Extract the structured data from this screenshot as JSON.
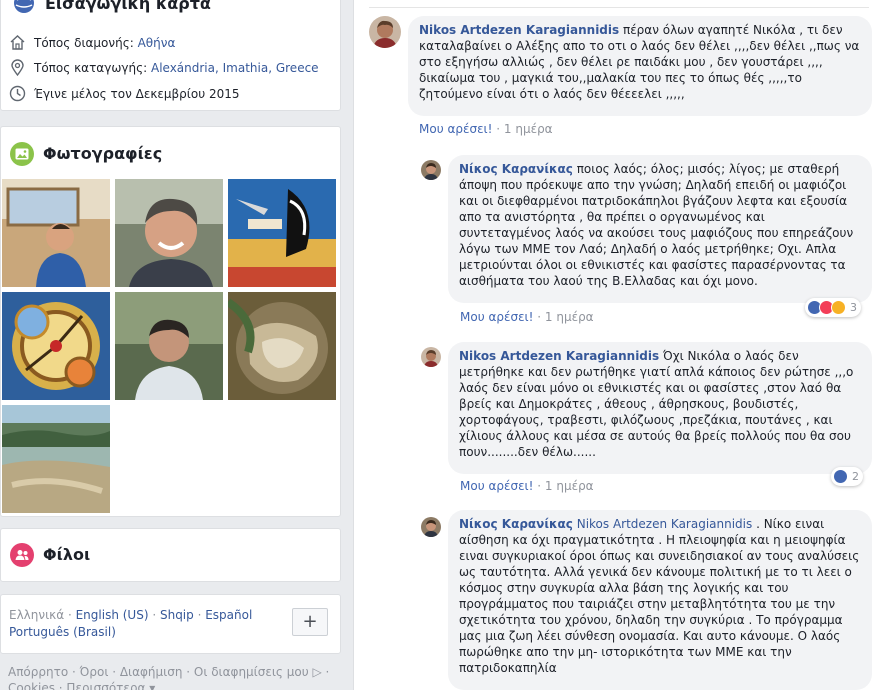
{
  "intro": {
    "title": "Εισαγωγική κάρτα",
    "rows": [
      {
        "label": "Τόπος διαμονής: ",
        "link": "Αθήνα",
        "icon": "home-icon"
      },
      {
        "label": "Τόπος καταγωγής: ",
        "link": "Alexándria, Imathia, Greece",
        "icon": "location-pin-icon"
      },
      {
        "label": "Έγινε μέλος τον Δεκεμβρίου 2015",
        "link": "",
        "icon": "clock-icon"
      }
    ]
  },
  "photos": {
    "title": "Φωτογραφίες",
    "icon": "photos-icon",
    "colors": {
      "accent": "#8bc34a"
    }
  },
  "friends": {
    "title": "Φίλοι",
    "icon": "friends-icon",
    "colors": {
      "accent": "#e4406f"
    }
  },
  "languages": {
    "current": "Ελληνικά",
    "items": [
      "English (US)",
      "Shqip",
      "Español",
      "Português (Brasil)"
    ],
    "sep": " · ",
    "add_label": "+"
  },
  "footer": {
    "line1": "Απόρρητο · Όροι · Διαφήμιση · Οι διαφημίσεις μου ▷ ·",
    "line2": "Cookies · Περισσότερα ▾"
  },
  "comments": [
    {
      "author": "Nikos Artdezen Karagiannidis",
      "text": " πέραν όλων αγαπητέ Νικόλα , τι δεν καταλαβαίνει ο Αλέξης απο το οτι ο λαός δεν θέλει ,,,,δεν θέλει ,,πως να στο εξηγήσω αλλιώς , δεν θέλει ρε παιδάκι μου , δεν γουστάρει ,,,, δικαίωμα του , μαγκιά του,,μαλακία του πες το όπως θές ,,,,,το ζητούμενο είναι ότι ο λαός δεν θέεεελει ,,,,,",
      "like_label": "Μου αρέσει!",
      "time": "1 ημέρα"
    },
    {
      "author": "Νίκος Καρανίκας",
      "text": " ποιος λαός; όλος; μισός; λίγος; με σταθερή άποψη που πρόεκυψε απο την γνώση; Δηλαδή επειδή οι μαφιόζοι και οι διεφθαρμένοι πατριδοκάπηλοι βγάζουν λεφτα και εξουσία απο τα ανιστόρητα , θα πρέπει ο οργανωμένος και συντεταγμένος λαός να ακούσει τους μαφιόζους που επηρεάζουν λόγω των ΜΜΕ τον Λαό; Δηλαδή ο λαός μετρήθηκε; Οχι. Απλα μετριούνται όλοι οι εθνικιστές και φασίστες παρασέρνοντας τα αισθήματα του λαού της Β.Ελλαδας και όχι μονο.",
      "like_label": "Μου αρέσει!",
      "time": "1 ημέρα",
      "reactions_count": "3"
    },
    {
      "author": "Nikos Artdezen Karagiannidis",
      "text": " Όχι Νικόλα ο λαός δεν μετρήθηκε και δεν ρωτήθηκε γιατί απλά κάποιος δεν ρώτησε ,,,ο λαός δεν είναι μόνο οι εθνικιστές και οι φασίστες ,στον λαό θα βρείς και Δημοκράτες , άθεους , άθρησκους, βουδιστές, χορτοφάγους, τραβεστι, φιλόζωους ,πρεζάκια, πουτάνες , και χίλιους άλλους και μέσα σε αυτούς θα βρείς πολλούς που θα σου πουν........δεν θέλω......",
      "like_label": "Μου αρέσει!",
      "time": "1 ημέρα",
      "reactions_count": "2"
    },
    {
      "author": "Νίκος Καρανίκας",
      "mention": "Nikos Artdezen Karagiannidis",
      "text": " . Νίκο ειναι αίσθηση κα όχι πραγματικότητα . Η πλειοψηφία και η μειοψηφία ειναι συγκυριακοί όροι όπως και συνειδησιακοί αν τους αναλύσεις ως ταυτότητα. Αλλά γενικά δεν κάνουμε πολιτική με το τι λεει ο κόσμος στην συγκυρία αλλα βάση της λογικής και του προγράμματος που ταιριάζει στην μεταβλητότητα του με την σχετικότητα του χρόνου, δηλαδη την συγκύρια . Το πρόγραμμα μας μια ζωη λέει σύνθεση ονομασία. Και αυτο κάνουμε. Ο λαός πωρώθηκε απο την μη- ιστορικότητα των ΜΜΕ και την πατριδοκαπηλία"
    }
  ]
}
